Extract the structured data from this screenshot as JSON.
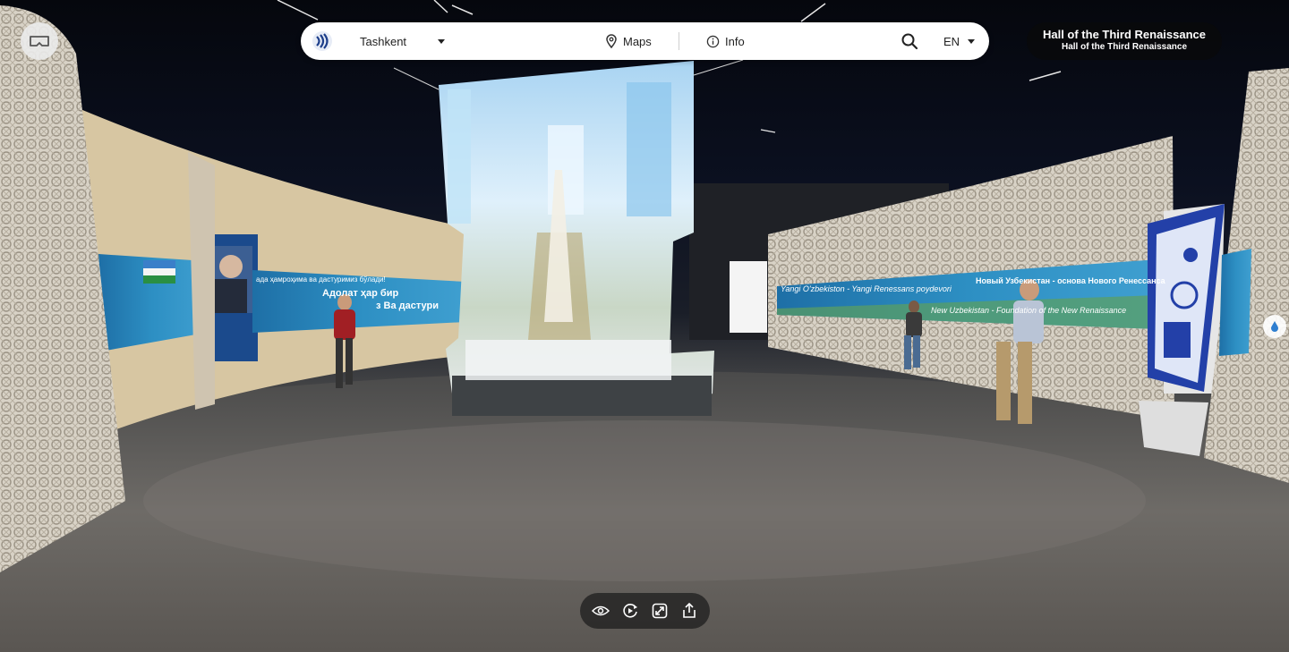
{
  "topbar": {
    "city": "Tashkent",
    "maps_label": "Maps",
    "info_label": "Info",
    "language": "EN"
  },
  "badge": {
    "title": "Hall of the Third Renaissance",
    "subtitle": "Hall of the Third Renaissance"
  },
  "scene": {
    "screen_left_line1": "ада ҳамроҳима ва дастуримиз бўлади!",
    "screen_left_line2": "Адолат ҳар бир",
    "screen_left_line3": "з Ва дастури",
    "screen_right_line1": "Yangi O'zbekiston - Yangi Renessans poydevori",
    "screen_right_line2": "Новый Узбекистан - основа Нового Ренессанса",
    "screen_right_line3": "New Uzbekistan - Foundation of the New Renaissance"
  },
  "colors": {
    "topbar_bg": "#ffffff",
    "badge_bg": "#0a0a0a",
    "toolbar_bg": "#1e1e1e",
    "logo_blue": "#1d3e8a"
  },
  "icons": {
    "vr": "vr-headset-icon",
    "logo": "logo-icon",
    "city_caret": "caret-down-icon",
    "maps": "map-pin-icon",
    "info": "info-icon",
    "search": "search-icon",
    "lang_caret": "caret-down-icon",
    "toolbar": [
      "eye-icon",
      "autorotate-icon",
      "fullscreen-icon",
      "share-icon"
    ],
    "side": "water-drop-icon"
  }
}
